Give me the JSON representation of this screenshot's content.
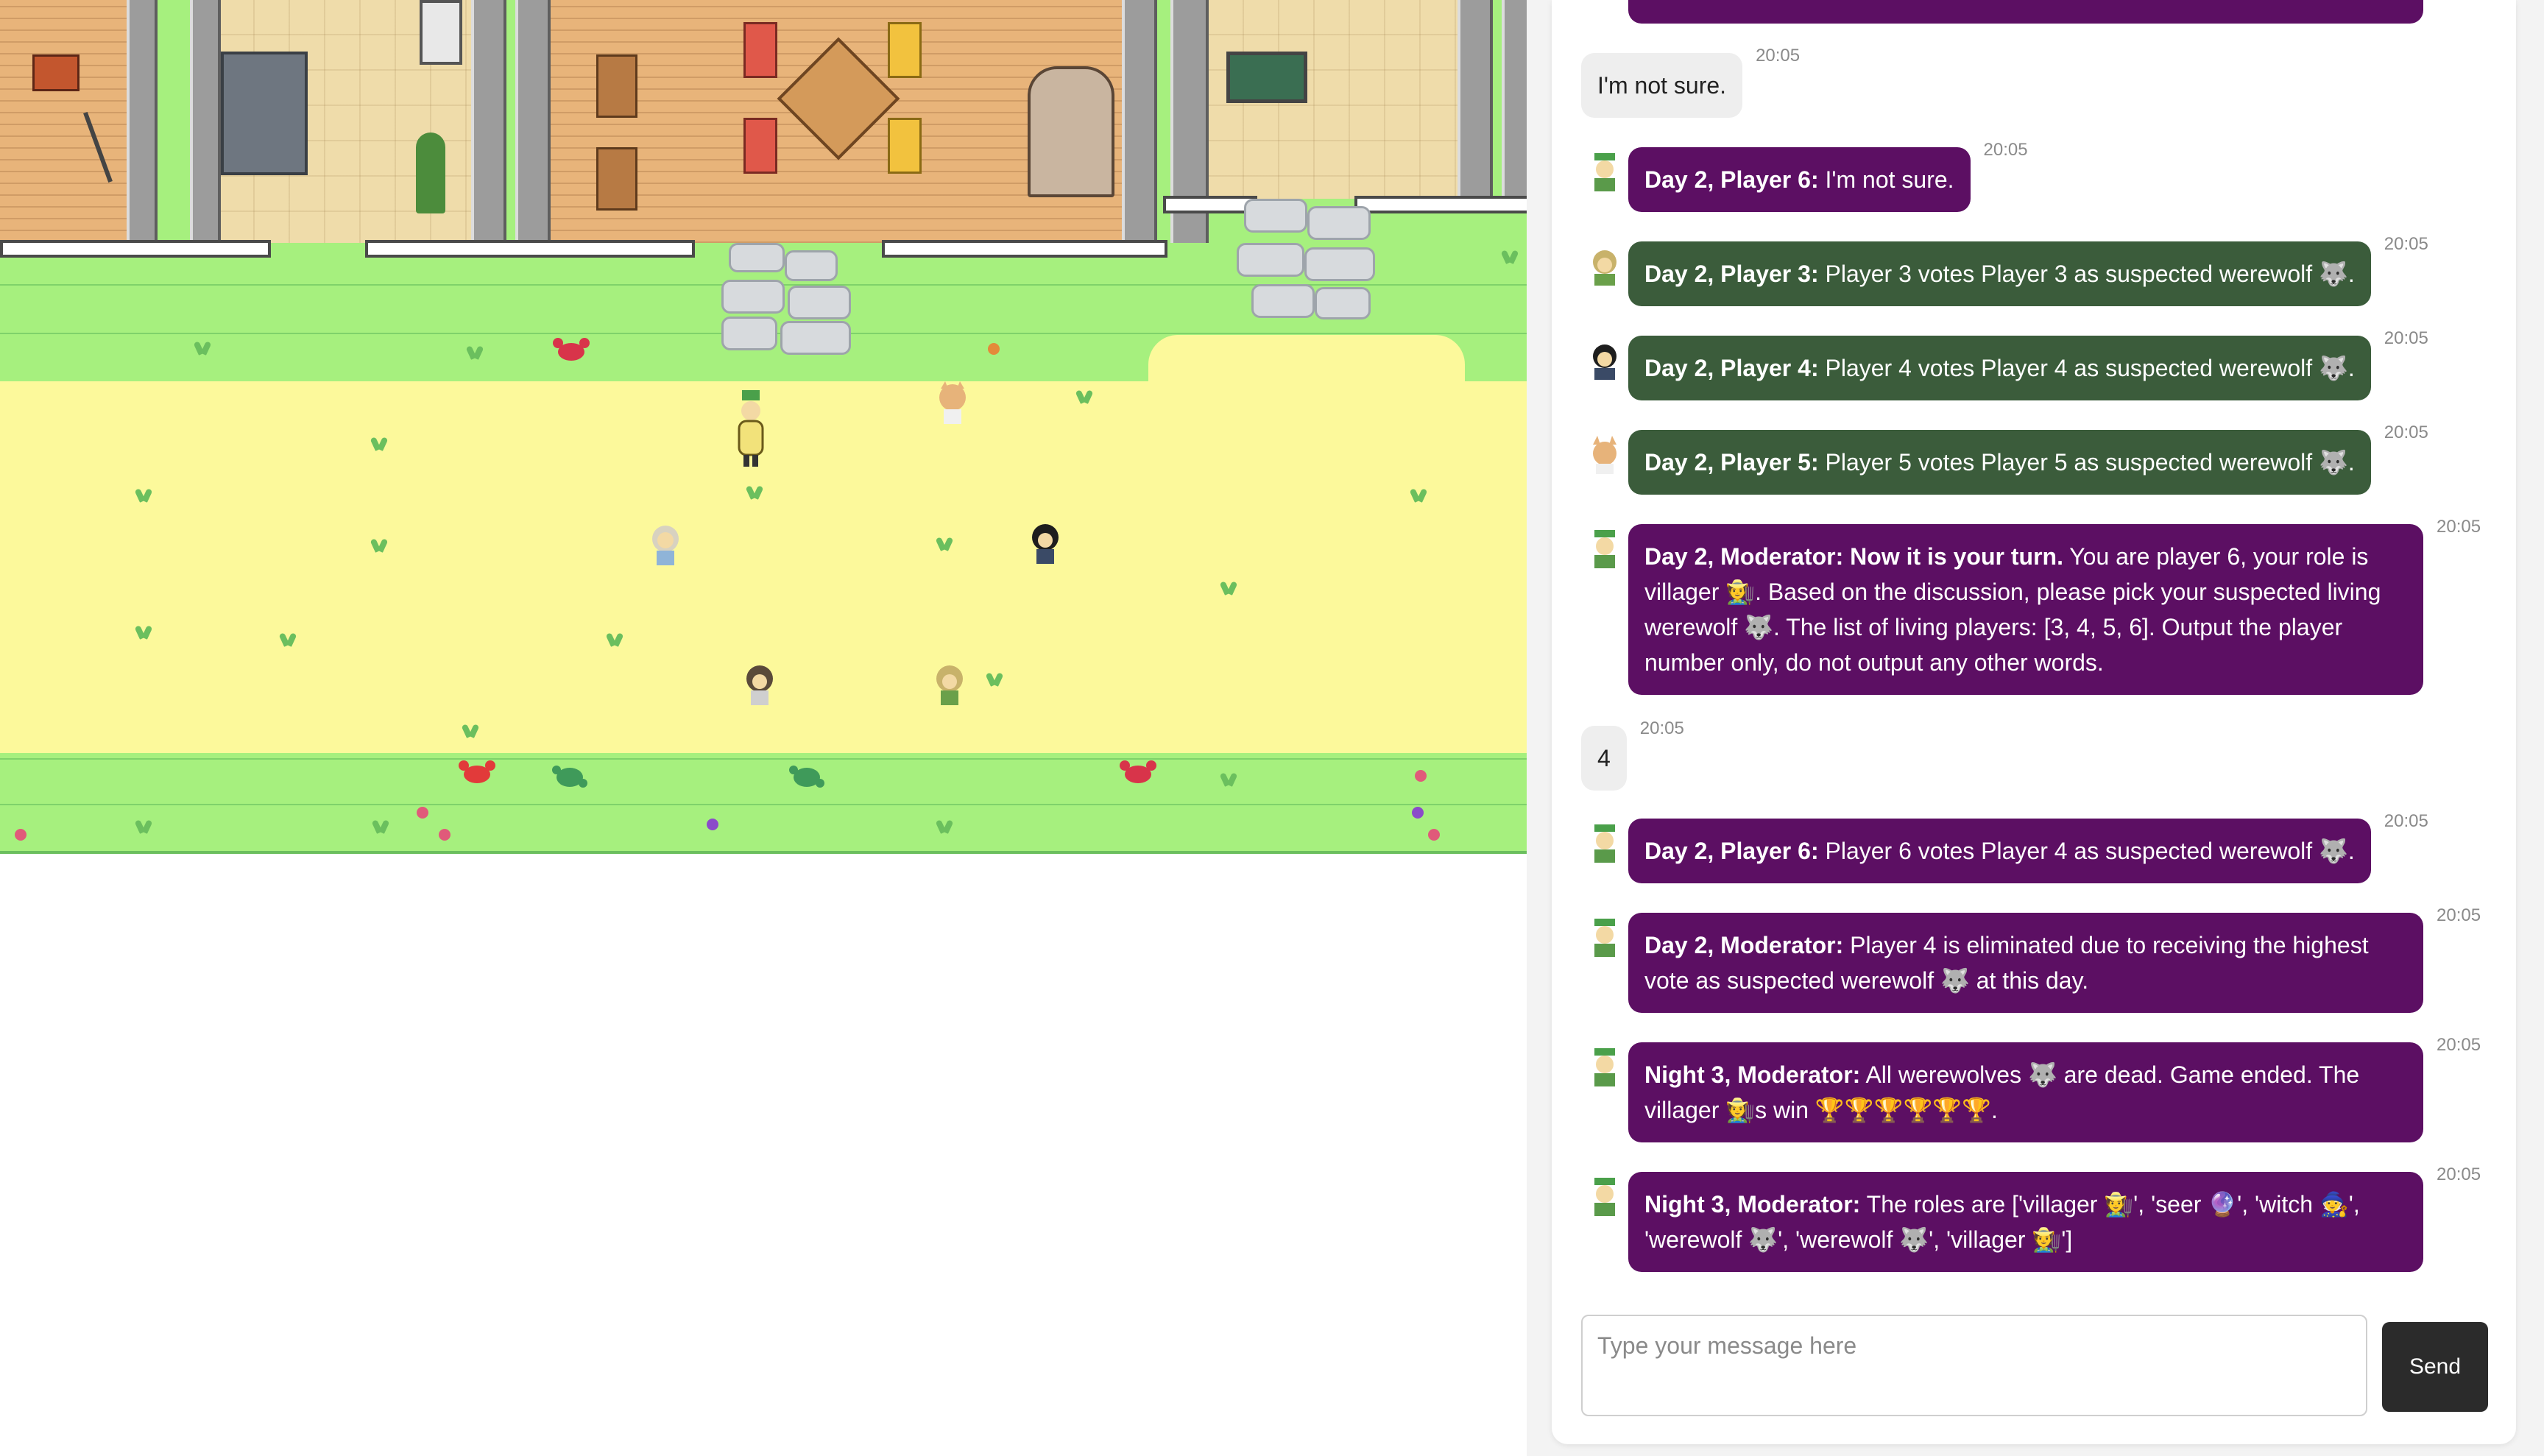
{
  "chat": {
    "messages": [
      {
        "type": "bot",
        "text": "I'm not sure.",
        "time": "20:05"
      },
      {
        "type": "purple",
        "speaker": "Day 2, Player 6:",
        "text": " I'm not sure.",
        "time": "20:05"
      },
      {
        "type": "green",
        "speaker": "Day 2, Player 3:",
        "text": " Player 3 votes Player 3 as suspected werewolf 🐺.",
        "time": "20:05"
      },
      {
        "type": "green",
        "speaker": "Day 2, Player 4:",
        "text": " Player 4 votes Player 4 as suspected werewolf 🐺.",
        "time": "20:05"
      },
      {
        "type": "green",
        "speaker": "Day 2, Player 5:",
        "text": " Player 5 votes Player 5 as suspected werewolf 🐺.",
        "time": "20:05"
      },
      {
        "type": "purple",
        "speaker": "Day 2, Moderator: Now it is your turn.",
        "text": " You are player 6, your role is villager 🧑‍🌾. Based on the discussion, please pick your suspected living werewolf 🐺. The list of living players: [3, 4, 5, 6]. Output the player number only, do not output any other words.",
        "time": "20:05"
      },
      {
        "type": "bot",
        "text": "4",
        "time": "20:05"
      },
      {
        "type": "purple",
        "speaker": "Day 2, Player 6:",
        "text": " Player 6 votes Player 4 as suspected werewolf 🐺.",
        "time": "20:05"
      },
      {
        "type": "purple",
        "speaker": "Day 2, Moderator:",
        "text": " Player 4 is eliminated due to receiving the highest vote as suspected werewolf 🐺 at this day.",
        "time": "20:05"
      },
      {
        "type": "purple",
        "speaker": "Night 3, Moderator:",
        "text": " All werewolves 🐺 are dead. Game ended. The villager 🧑‍🌾s win 🏆🏆🏆🏆🏆🏆.",
        "time": "20:05"
      },
      {
        "type": "purple",
        "speaker": "Night 3, Moderator:",
        "text": " The roles are ['villager 🧑‍🌾', 'seer 🔮', 'witch 🧙', 'werewolf 🐺', 'werewolf 🐺', 'villager 🧑‍🌾']",
        "time": "20:05"
      }
    ],
    "input_placeholder": "Type your message here",
    "send_label": "Send"
  },
  "colors": {
    "purple_bubble": "#5c0f63",
    "green_bubble": "#3b5c3b",
    "grass": "#a6f07e",
    "path": "#fcf99b",
    "send_button": "#2b2b2b"
  }
}
